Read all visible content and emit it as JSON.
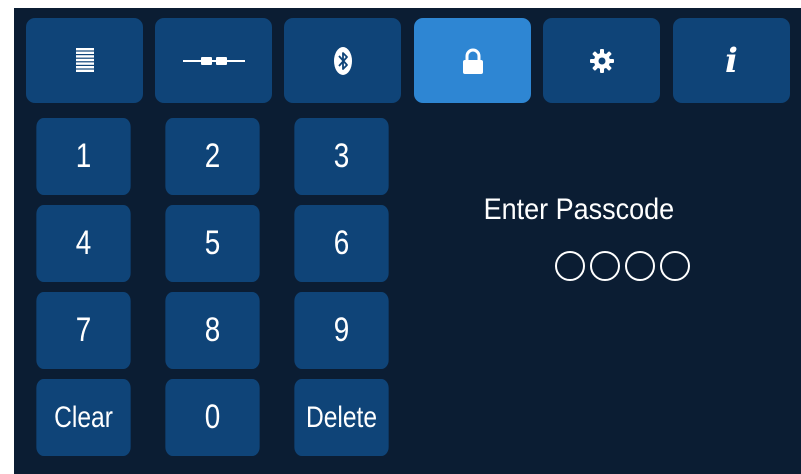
{
  "tabs": [
    {
      "icon": "list-icon",
      "active": false
    },
    {
      "icon": "connector-icon",
      "active": false
    },
    {
      "icon": "bluetooth-icon",
      "active": false
    },
    {
      "icon": "lock-icon",
      "active": true
    },
    {
      "icon": "gear-icon",
      "active": false
    },
    {
      "icon": "info-icon",
      "active": false,
      "label": "i"
    }
  ],
  "keypad": {
    "k1": "1",
    "k2": "2",
    "k3": "3",
    "k4": "4",
    "k5": "5",
    "k6": "6",
    "k7": "7",
    "k8": "8",
    "k9": "9",
    "clear": "Clear",
    "k0": "0",
    "delete": "Delete"
  },
  "passcode": {
    "prompt": "Enter Passcode",
    "length": 4,
    "entered": 0
  },
  "colors": {
    "background": "#0b1d33",
    "button": "#0f4478",
    "active_tab": "#2e86d3",
    "text": "#ffffff"
  }
}
